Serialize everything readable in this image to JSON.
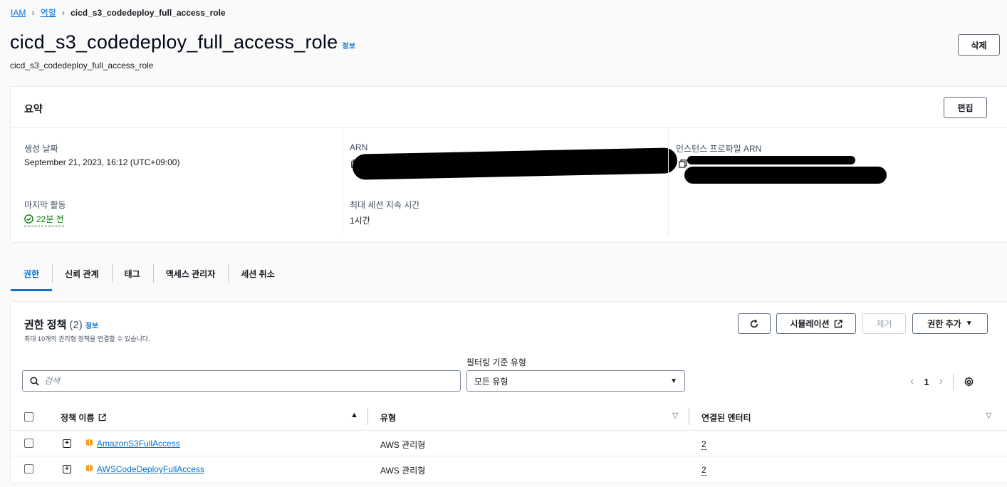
{
  "breadcrumb": {
    "root": "IAM",
    "parent": "역할",
    "current": "cicd_s3_codedeploy_full_access_role"
  },
  "header": {
    "title": "cicd_s3_codedeploy_full_access_role",
    "info": "정보",
    "subtitle": "cicd_s3_codedeploy_full_access_role",
    "delete_label": "삭제"
  },
  "summary": {
    "title": "요약",
    "edit_label": "편집",
    "created_label": "생성 날짜",
    "created_value": "September 21, 2023, 16:12 (UTC+09:00)",
    "last_activity_label": "마지막 활동",
    "last_activity_value": "22분 전",
    "arn_label": "ARN",
    "max_session_label": "최대 세션 지속 시간",
    "max_session_value": "1시간",
    "instance_profile_label": "인스턴스 프로파일 ARN"
  },
  "tabs": [
    "권한",
    "신뢰 관계",
    "태그",
    "액세스 관리자",
    "세션 취소"
  ],
  "permissions": {
    "title": "권한 정책",
    "count": "(2)",
    "info": "정보",
    "description": "최대 10개의 관리형 정책을 연결할 수 있습니다.",
    "simulate_label": "시뮬레이션",
    "remove_label": "제거",
    "add_label": "권한 추가",
    "search_placeholder": "검색",
    "filter_label": "필터링 기준 유형",
    "filter_value": "모든 유형",
    "page": "1",
    "columns": {
      "name": "정책 이름",
      "type": "유형",
      "entities": "연결된 엔터티"
    },
    "rows": [
      {
        "name": "AmazonS3FullAccess",
        "type": "AWS 관리형",
        "entities": "2"
      },
      {
        "name": "AWSCodeDeployFullAccess",
        "type": "AWS 관리형",
        "entities": "2"
      }
    ]
  },
  "colors": {
    "link": "#0972d3",
    "success": "#037f0c",
    "policy_icon": "#f59c1a"
  }
}
